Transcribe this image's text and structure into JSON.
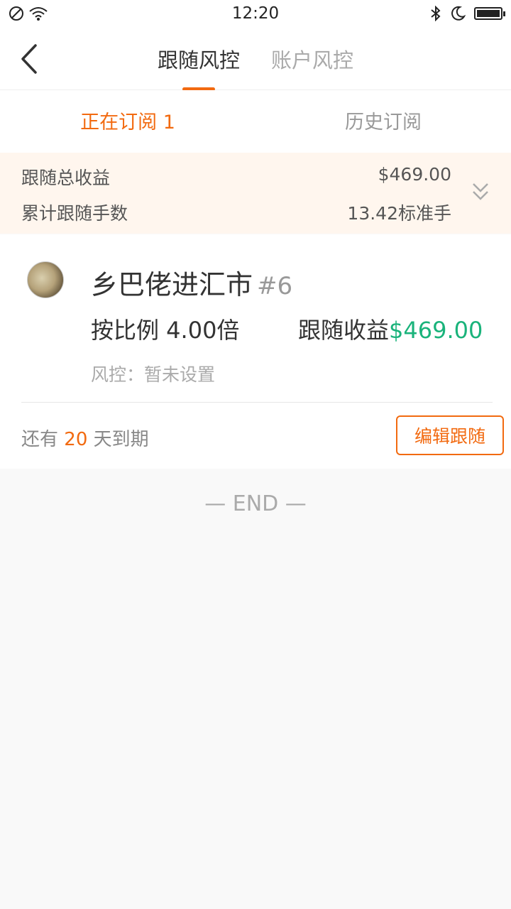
{
  "status_bar": {
    "time": "12:20",
    "icons": [
      "dnd-icon",
      "wifi-icon",
      "bluetooth-icon",
      "moon-icon",
      "battery-icon"
    ]
  },
  "nav": {
    "tabs": [
      {
        "label": "跟随风控",
        "active": true
      },
      {
        "label": "账户风控",
        "active": false
      }
    ]
  },
  "sub_tabs": [
    {
      "label": "正在订阅 1",
      "active": true
    },
    {
      "label": "历史订阅",
      "active": false
    }
  ],
  "summary": {
    "total_profit_label": "跟随总收益",
    "total_profit_value": "$469.00",
    "total_lots_label": "累计跟随手数",
    "total_lots_value": "13.42标准手"
  },
  "subscription": {
    "name": "乡巴佬进汇市",
    "tag": "#6",
    "ratio_text": "按比例 4.00倍",
    "profit_label": "跟随收益",
    "profit_value": "$469.00",
    "risk_text": "风控：暂未设置",
    "expiry_prefix": "还有",
    "expiry_days": "20",
    "expiry_suffix": "天到期",
    "edit_label": "编辑跟随"
  },
  "end_text": "— END —",
  "colors": {
    "accent": "#f26a10",
    "profit_green": "#1ab37b",
    "summary_bg": "#fff6ee"
  }
}
